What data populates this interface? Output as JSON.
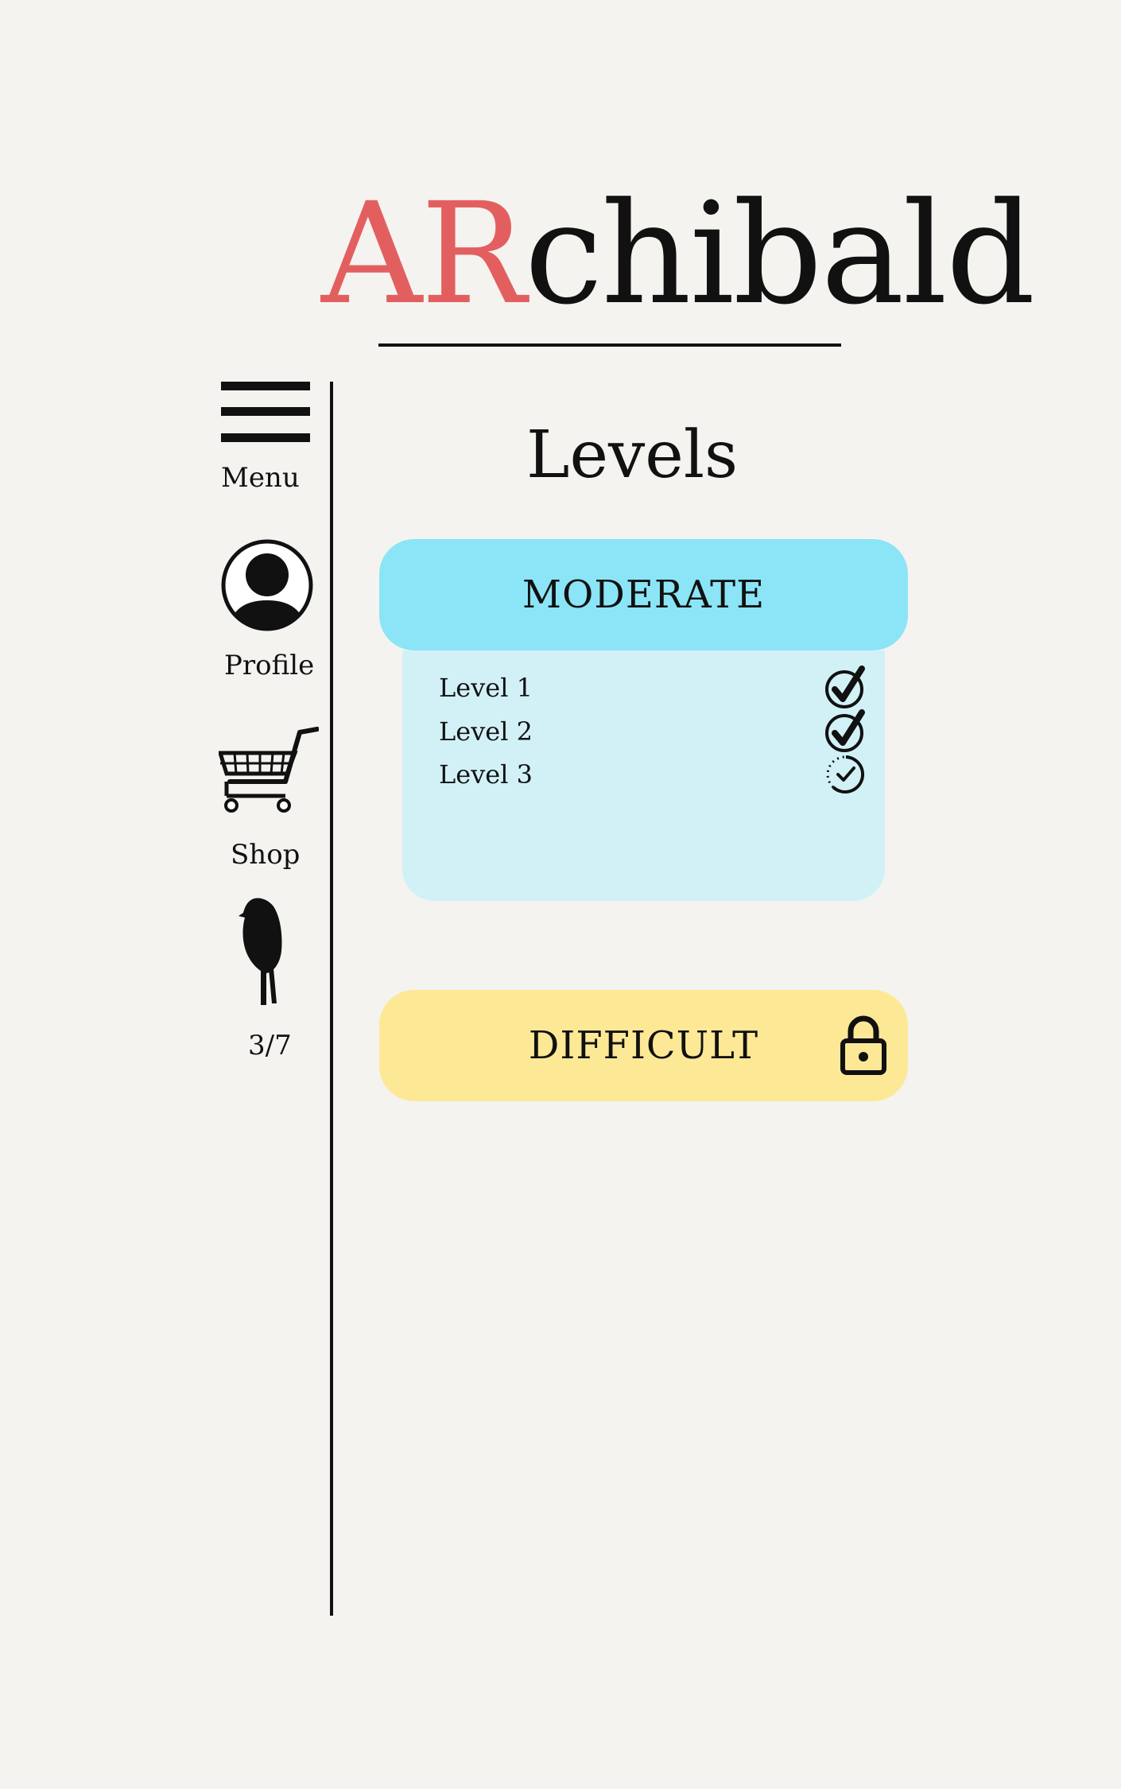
{
  "app": {
    "logo_accent": "AR",
    "logo_rest": "chibald",
    "accent_color": "#e35f5f"
  },
  "sidebar": {
    "items": [
      {
        "label": "Menu",
        "icon": "hamburger-menu-icon"
      },
      {
        "label": "Profile",
        "icon": "user-avatar-icon"
      },
      {
        "label": "Shop",
        "icon": "shopping-cart-icon"
      },
      {
        "label": "3/7",
        "icon": "bird-icon"
      }
    ]
  },
  "main": {
    "title": "Levels",
    "sections": [
      {
        "name": "MODERATE",
        "color": "#8be5f6",
        "panel_color": "#d1f1f7",
        "levels": [
          {
            "label": "Level 1",
            "status": "completed",
            "icon": "check-circle-icon"
          },
          {
            "label": "Level 2",
            "status": "completed",
            "icon": "check-circle-icon"
          },
          {
            "label": "Level 3",
            "status": "in-progress",
            "icon": "dotted-check-circle-icon"
          }
        ]
      },
      {
        "name": "DIFFICULT",
        "color": "#fde896",
        "locked": true,
        "icon": "lock-icon"
      }
    ]
  }
}
